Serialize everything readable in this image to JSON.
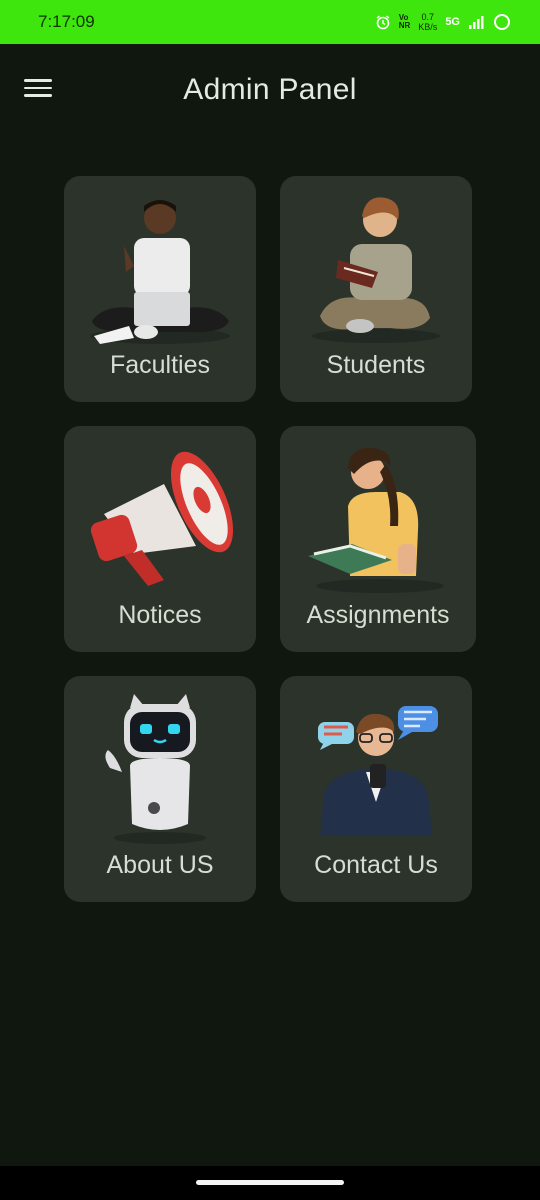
{
  "status": {
    "time": "7:17:09",
    "volte": "Vo\nNR",
    "speed": "0.7",
    "speed_unit": "KB/s",
    "network": "5G"
  },
  "header": {
    "title": "Admin Panel"
  },
  "cards": [
    {
      "label": "Faculties",
      "icon": "person-with-laptop"
    },
    {
      "label": "Students",
      "icon": "boy-reading-book"
    },
    {
      "label": "Notices",
      "icon": "megaphone"
    },
    {
      "label": "Assignments",
      "icon": "girl-reading-notebook"
    },
    {
      "label": "About US",
      "icon": "robot"
    },
    {
      "label": "Contact Us",
      "icon": "man-with-phone-chat-bubbles"
    }
  ],
  "colors": {
    "statusbar": "#3ee60e",
    "background": "#0f170f",
    "card": "#2b332a",
    "text": "#d7ddd3"
  }
}
